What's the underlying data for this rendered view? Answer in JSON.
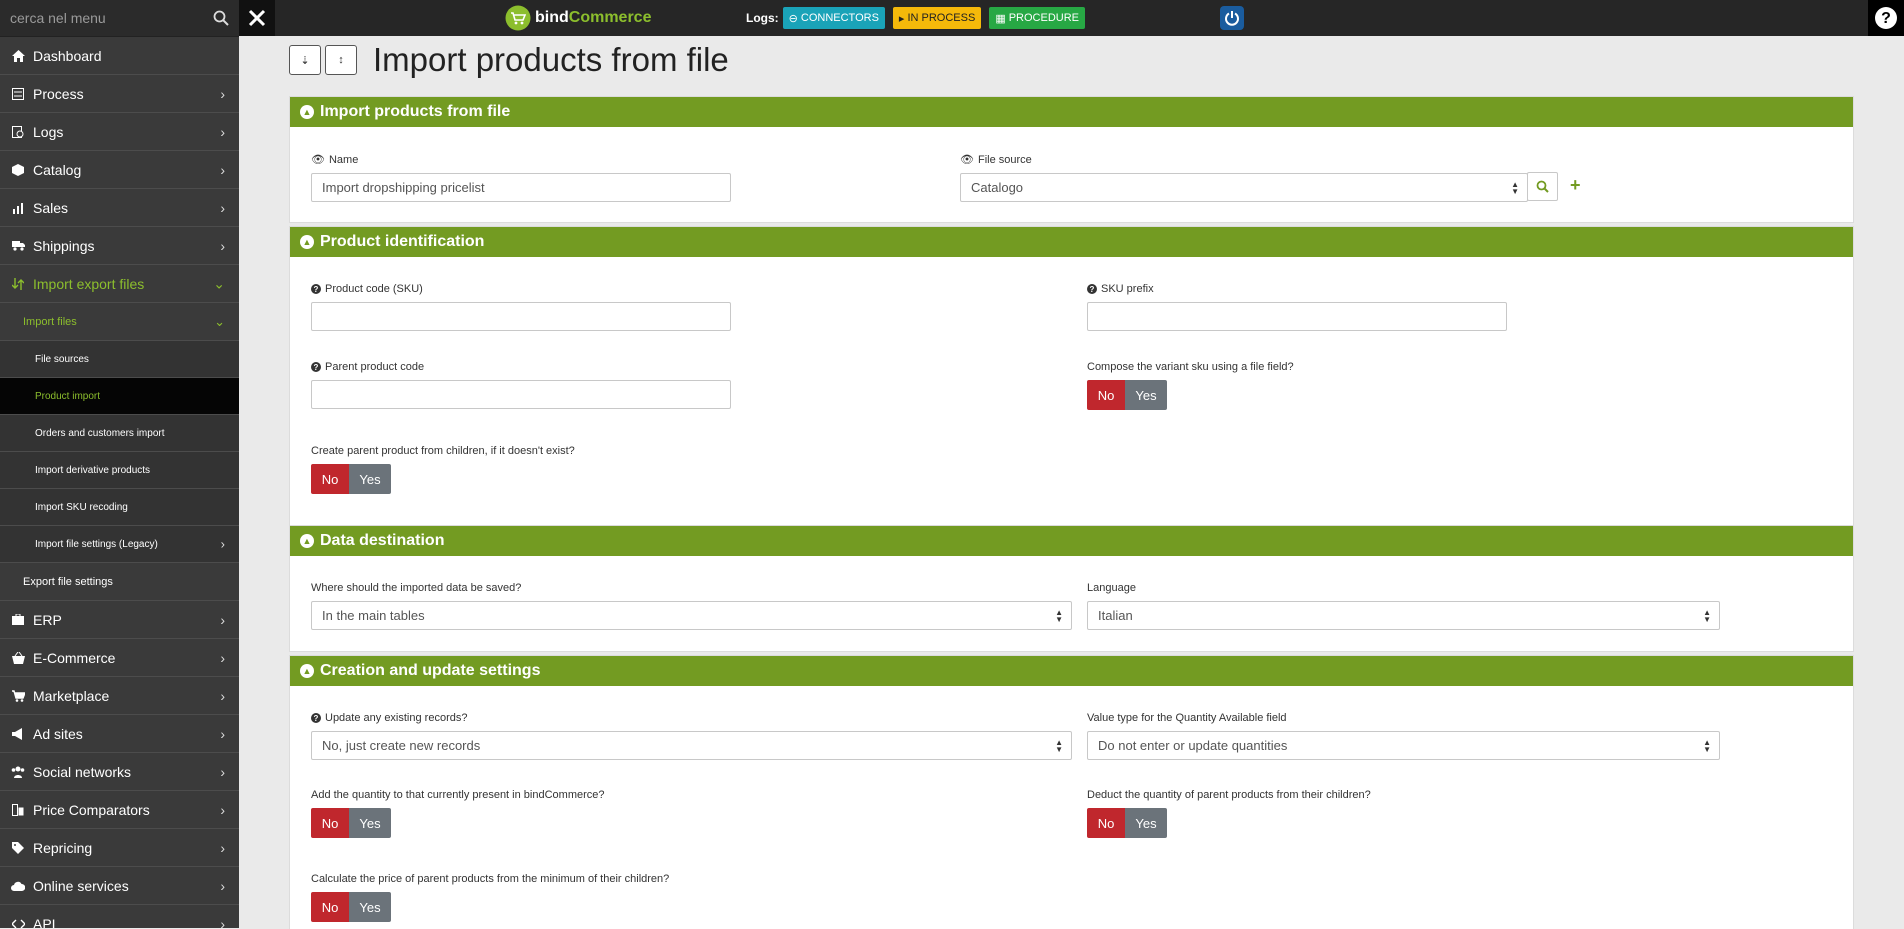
{
  "sidebar": {
    "search_placeholder": "cerca nel menu",
    "items": [
      {
        "label": "Dashboard",
        "icon": "home-icon"
      },
      {
        "label": "Process",
        "icon": "process-icon"
      },
      {
        "label": "Logs",
        "icon": "logs-icon"
      },
      {
        "label": "Catalog",
        "icon": "catalog-icon"
      },
      {
        "label": "Sales",
        "icon": "sales-icon"
      },
      {
        "label": "Shippings",
        "icon": "truck-icon"
      },
      {
        "label": "Import export files",
        "icon": "import-export-icon"
      }
    ],
    "import_files": "Import files",
    "sub_items": [
      "File sources",
      "Product import",
      "Orders and customers import",
      "Import derivative products",
      "Import SKU recoding",
      "Import file settings (Legacy)"
    ],
    "export_file_settings": "Export file settings",
    "items2": [
      {
        "label": "ERP",
        "icon": "erp-icon"
      },
      {
        "label": "E-Commerce",
        "icon": "basket-icon"
      },
      {
        "label": "Marketplace",
        "icon": "cart-icon"
      },
      {
        "label": "Ad sites",
        "icon": "megaphone-icon"
      },
      {
        "label": "Social networks",
        "icon": "users-icon"
      },
      {
        "label": "Price Comparators",
        "icon": "compare-icon"
      },
      {
        "label": "Repricing",
        "icon": "tag-icon"
      },
      {
        "label": "Online services",
        "icon": "cloud-icon"
      },
      {
        "label": "API",
        "icon": "api-icon"
      }
    ]
  },
  "topbar": {
    "logo_bind": "bind",
    "logo_commerce": "Commerce",
    "logs_label": "Logs:",
    "connectors": "CONNECTORS",
    "in_process": "IN PROCESS",
    "procedure": "PROCEDURE",
    "help": "?"
  },
  "page": {
    "title": "Import products from file"
  },
  "sections": {
    "import": {
      "title": "Import products from file",
      "name_label": "Name",
      "name_value": "Import dropshipping pricelist",
      "file_source_label": "File source",
      "file_source_value": "Catalogo"
    },
    "identification": {
      "title": "Product identification",
      "sku_label": "Product code (SKU)",
      "sku_prefix_label": "SKU prefix",
      "parent_code_label": "Parent product code",
      "compose_label": "Compose the variant sku using a file field?",
      "create_parent_label": "Create parent product from children, if it doesn't exist?"
    },
    "destination": {
      "title": "Data destination",
      "where_label": "Where should the imported data be saved?",
      "where_value": "In the main tables",
      "language_label": "Language",
      "language_value": "Italian"
    },
    "creation": {
      "title": "Creation and update settings",
      "update_label": "Update any existing records?",
      "update_value": "No, just create new records",
      "qty_type_label": "Value type for the Quantity Available field",
      "qty_type_value": "Do not enter or update quantities",
      "add_qty_label": "Add the quantity to that currently present in bindCommerce?",
      "deduct_label": "Deduct the quantity of parent products from their children?",
      "calc_price_label": "Calculate the price of parent products from the minimum of their children?"
    }
  },
  "toggle": {
    "no": "No",
    "yes": "Yes"
  },
  "colors": {
    "accent_green": "#739b22",
    "menu_green": "#8cbe2d",
    "no_red": "#c0272d",
    "yes_gray": "#6b737a",
    "connectors": "#1aa3b8",
    "in_process": "#f5b90a",
    "procedure": "#27a844"
  }
}
